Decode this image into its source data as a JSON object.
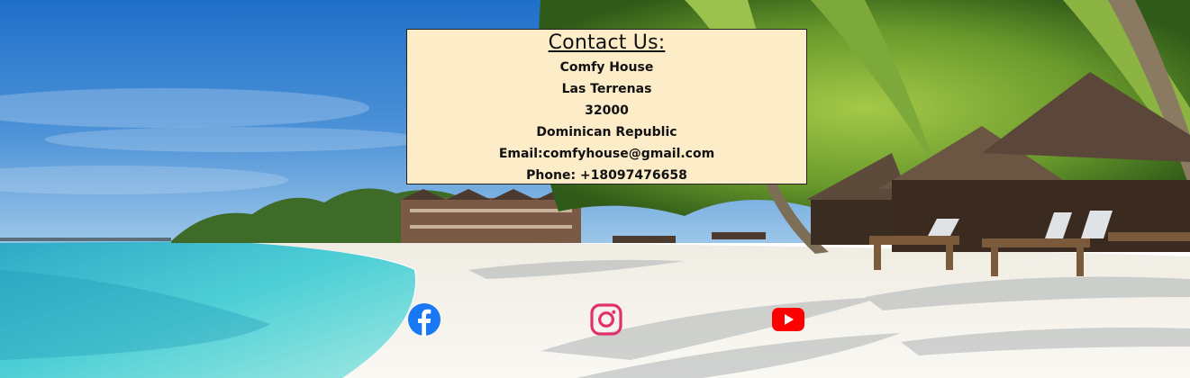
{
  "contact": {
    "title": "Contact Us:",
    "lines": [
      "Comfy House",
      "Las Terrenas",
      "32000",
      "Dominican Republic",
      "Email:comfyhouse@gmail.com",
      "Phone: +18097476658"
    ]
  },
  "social_links": [
    {
      "icon": "facebook-icon",
      "color": "#1877f2"
    },
    {
      "icon": "instagram-icon",
      "color": "#e1306c"
    },
    {
      "icon": "youtube-icon",
      "color": "#ff0000"
    }
  ],
  "colors": {
    "contact_bg": "#fdecc8",
    "sky": "#2f7fd0",
    "sea": "#3cc4cf",
    "sand": "#f4f1ea"
  }
}
